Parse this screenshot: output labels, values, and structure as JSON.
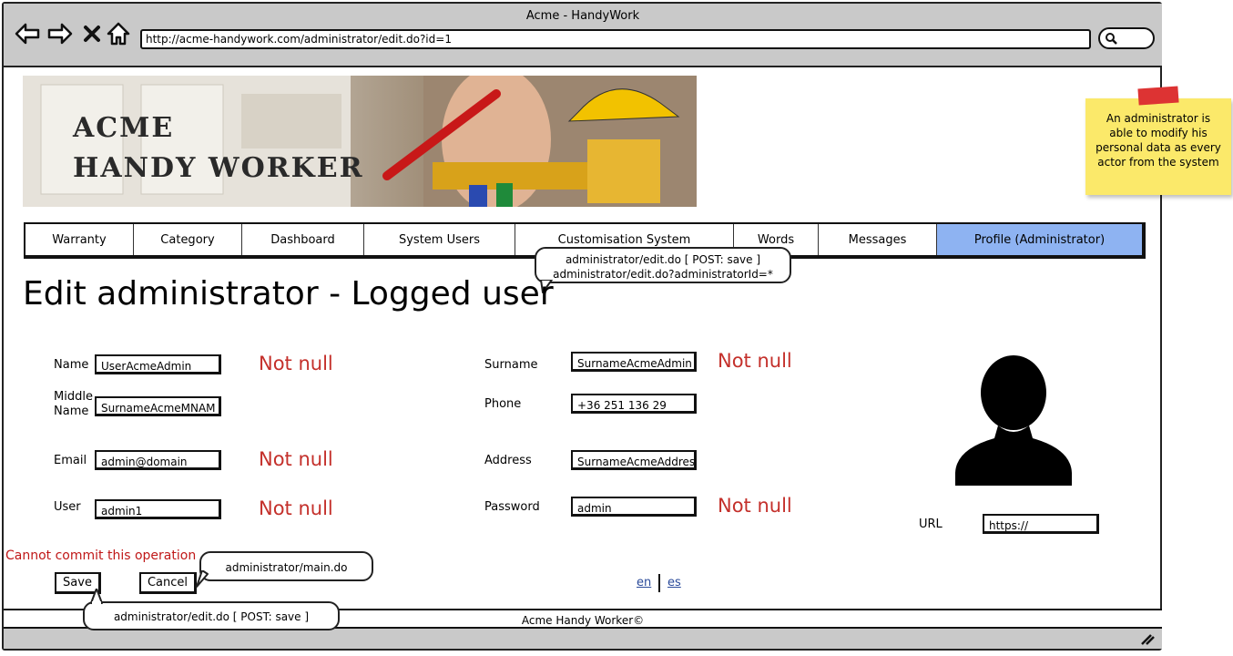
{
  "window": {
    "title": "Acme - HandyWork",
    "url": "http://acme-handywork.com/administrator/edit.do?id=1"
  },
  "banner": {
    "line1": "ACME",
    "line2": "HANDY WORKER"
  },
  "sticky_note": "An administrator is able to modify his personal data as every actor from the system",
  "nav": {
    "items": [
      {
        "label": "Warranty"
      },
      {
        "label": "Category"
      },
      {
        "label": "Dashboard"
      },
      {
        "label": "System Users"
      },
      {
        "label": "Customisation System"
      },
      {
        "label": "Words"
      },
      {
        "label": "Messages"
      },
      {
        "label": "Profile (Administrator)"
      }
    ]
  },
  "callout_top": {
    "line1": "administrator/edit.do [ POST: save ]",
    "line2": "administrator/edit.do?administratorId=*"
  },
  "page_title": "Edit administrator - Logged user",
  "form": {
    "name_label": "Name",
    "name_value": "UserAcmeAdmin",
    "middle_label1": "Middle",
    "middle_label2": "Name",
    "middle_value": "SurnameAcmeMNAM",
    "email_label": "Email",
    "email_value": "admin@domain",
    "user_label": "User",
    "user_value": "admin1",
    "surname_label": "Surname",
    "surname_value": "SurnameAcmeAdmin",
    "phone_label": "Phone",
    "phone_value": "+36 251 136 29",
    "address_label": "Address",
    "address_value": "SurnameAcmeAddres",
    "password_label": "Password",
    "password_value": "admin",
    "url_label": "URL",
    "url_value": "https://",
    "required": "Not null"
  },
  "error": "Cannot commit this operation",
  "buttons": {
    "save": "Save",
    "cancel": "Cancel"
  },
  "callout_cancel": "administrator/main.do",
  "callout_save": "administrator/edit.do [ POST: save ]",
  "languages": {
    "en": "en",
    "es": "es"
  },
  "footer": "Acme Handy Worker©"
}
